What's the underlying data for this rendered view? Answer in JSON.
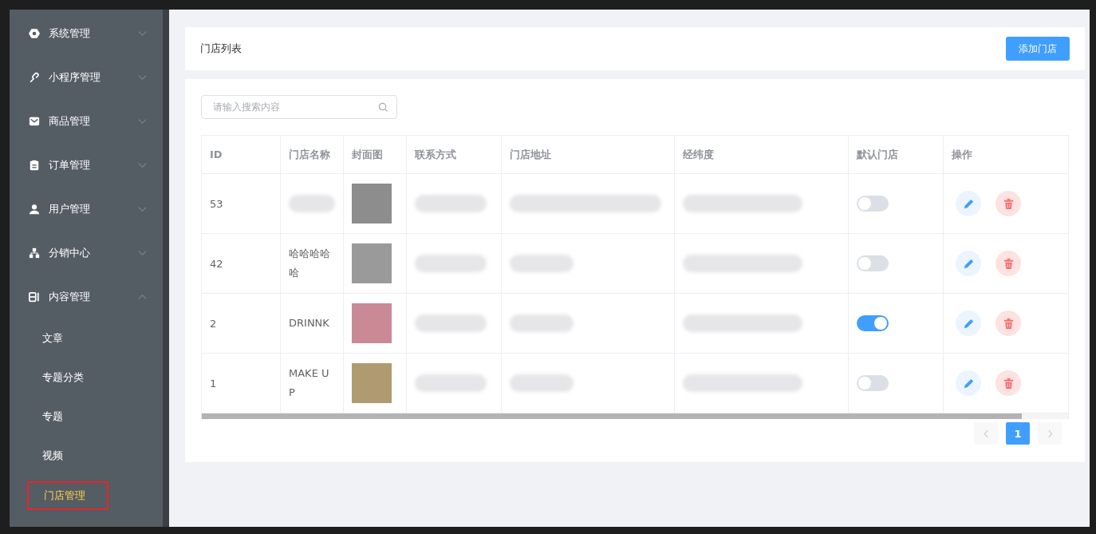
{
  "sidebar": {
    "items": [
      {
        "label": "系统管理",
        "expanded": false
      },
      {
        "label": "小程序管理",
        "expanded": false
      },
      {
        "label": "商品管理",
        "expanded": false
      },
      {
        "label": "订单管理",
        "expanded": false
      },
      {
        "label": "用户管理",
        "expanded": false
      },
      {
        "label": "分销中心",
        "expanded": false
      },
      {
        "label": "内容管理",
        "expanded": true,
        "children": [
          {
            "label": "文章",
            "selected": false,
            "highlighted": false
          },
          {
            "label": "专题分类",
            "selected": false,
            "highlighted": false
          },
          {
            "label": "专题",
            "selected": false,
            "highlighted": false
          },
          {
            "label": "视频",
            "selected": false,
            "highlighted": false
          },
          {
            "label": "门店管理",
            "selected": true,
            "highlighted": true
          }
        ]
      }
    ]
  },
  "header": {
    "title": "门店列表",
    "add_button": "添加门店"
  },
  "search": {
    "placeholder": "请输入搜索内容"
  },
  "table": {
    "columns": [
      "ID",
      "门店名称",
      "封面图",
      "联系方式",
      "门店地址",
      "经纬度",
      "默认门店",
      "操作"
    ],
    "rows": [
      {
        "id": "53",
        "default": false
      },
      {
        "id": "42",
        "name": "哈哈哈哈哈",
        "default": false
      },
      {
        "id": "2",
        "name": "DRINNK",
        "default": true
      },
      {
        "id": "1",
        "name": "MAKE UP",
        "default": false
      }
    ]
  },
  "pagination": {
    "prev_disabled": true,
    "pages": [
      {
        "label": "1",
        "selected": true
      }
    ],
    "next_disabled": true
  }
}
